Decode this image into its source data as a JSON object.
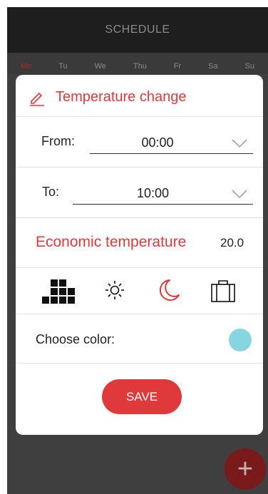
{
  "header": {
    "title": "SCHEDULE"
  },
  "days": [
    "Mo",
    "Tu",
    "We",
    "Thu",
    "Fr",
    "Sa",
    "Su"
  ],
  "fab": {
    "label": "+"
  },
  "modal": {
    "title": "Temperature change",
    "from": {
      "label": "From:",
      "value": "00:00"
    },
    "to": {
      "label": "To:",
      "value": "10:00"
    },
    "temperature": {
      "label": "Economic temperature",
      "value": "20.0"
    },
    "mode_icons": [
      "grid-icon",
      "sun-icon",
      "moon-icon",
      "suitcase-icon"
    ],
    "color": {
      "label": "Choose color:",
      "value": "#86d6e2"
    },
    "save_label": "SAVE"
  },
  "colors": {
    "accent": "#e0393b",
    "header_bg": "#1e1e1e"
  }
}
